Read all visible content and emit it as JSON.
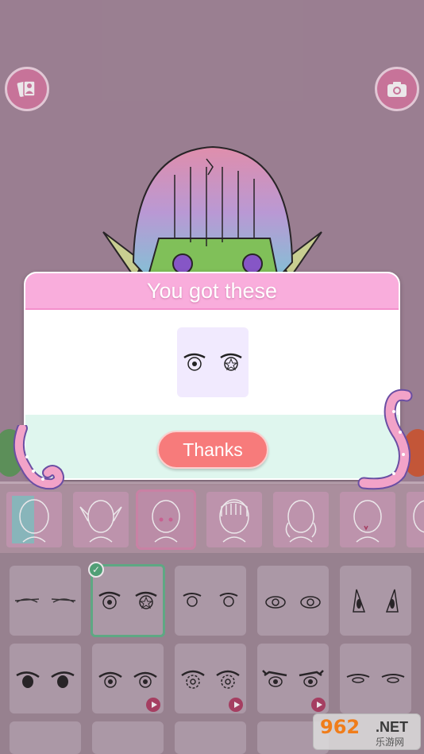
{
  "toolbar": {
    "gallery_icon": "photo-album-icon",
    "camera_icon": "camera-icon"
  },
  "modal": {
    "title": "You got these",
    "button_label": "Thanks",
    "reward_icon": "anime-eyes-icon"
  },
  "tabs": [
    {
      "name": "head-base"
    },
    {
      "name": "head-elf-ears"
    },
    {
      "name": "head-round",
      "selected": true
    },
    {
      "name": "head-bangs"
    },
    {
      "name": "head-braids"
    },
    {
      "name": "head-fangs"
    },
    {
      "name": "head-partial"
    }
  ],
  "eye_options": [
    {
      "style": "sleepy",
      "locked": false
    },
    {
      "style": "sparkle-star",
      "selected": true,
      "locked": false
    },
    {
      "style": "round-small",
      "locked": false
    },
    {
      "style": "wide",
      "locked": false
    },
    {
      "style": "oval-tall",
      "locked": false
    },
    {
      "style": "sharp",
      "locked": false
    },
    {
      "style": "ringed",
      "locked": true
    },
    {
      "style": "gear",
      "locked": true
    },
    {
      "style": "lashed",
      "locked": true
    },
    {
      "style": "narrow",
      "locked": false
    }
  ],
  "colors": {
    "modal_header": "#f9addc",
    "thanks_button": "#f77b7b",
    "selected_outline": "#5fb88a",
    "stage_bg": "#a3889a"
  },
  "watermark": {
    "number": "962",
    "suffix": ".NET",
    "caption": "乐游网"
  }
}
